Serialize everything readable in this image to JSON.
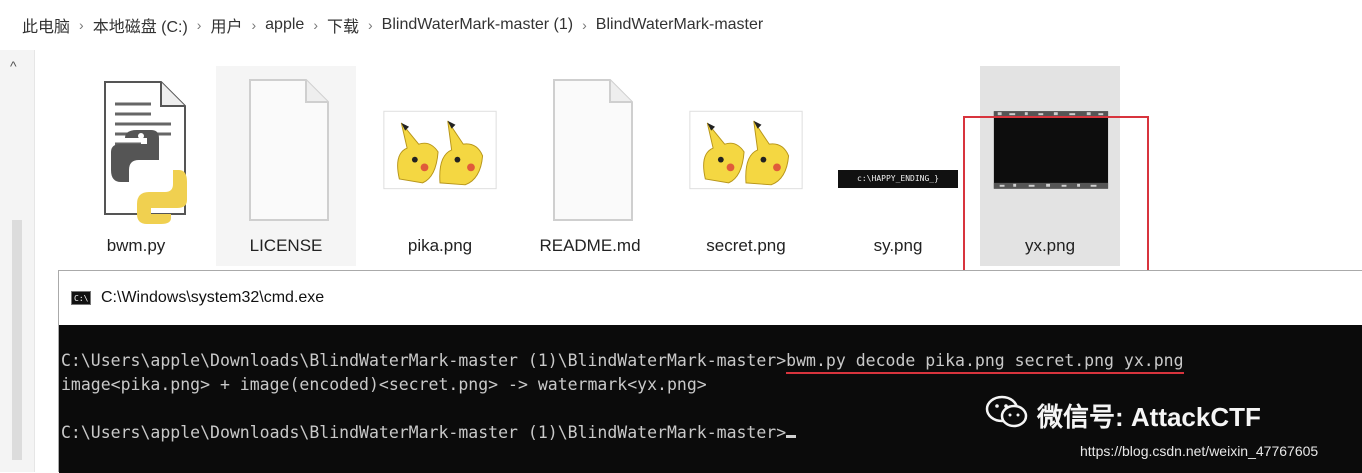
{
  "breadcrumb": [
    "此电脑",
    "本地磁盘 (C:)",
    "用户",
    "apple",
    "下载",
    "BlindWaterMark-master (1)",
    "BlindWaterMark-master"
  ],
  "breadcrumb_separator": "›",
  "files": [
    {
      "name": "bwm.py",
      "icon": "python-file-icon"
    },
    {
      "name": "LICENSE",
      "icon": "blank-file-icon"
    },
    {
      "name": "pika.png",
      "icon": "pikachu-image-icon"
    },
    {
      "name": "README.md",
      "icon": "blank-file-icon"
    },
    {
      "name": "secret.png",
      "icon": "pikachu-image-icon"
    },
    {
      "name": "sy.png",
      "icon": "watermark-text-image-icon",
      "thumb_text": "c:\\HAPPY_ENDING_}"
    },
    {
      "name": "yx.png",
      "icon": "black-noise-image-icon"
    }
  ],
  "cmd": {
    "title": "C:\\Windows\\system32\\cmd.exe",
    "icon_text": "C:\\",
    "prompt1": "C:\\Users\\apple\\Downloads\\BlindWaterMark-master (1)\\BlindWaterMark-master>",
    "command": "bwm.py decode pika.png secret.png yx.png",
    "output": "image<pika.png> + image(encoded)<secret.png> -> watermark<yx.png>",
    "prompt2": "C:\\Users\\apple\\Downloads\\BlindWaterMark-master (1)\\BlindWaterMark-master>"
  },
  "watermark": {
    "label": "微信号: AttackCTF",
    "icon": "wechat-icon"
  },
  "footer_url": "https://blog.csdn.net/weixin_47767605",
  "colors": {
    "highlight": "#d8343d",
    "console_bg": "#0b0b0b",
    "console_fg": "#c9c9c9"
  }
}
